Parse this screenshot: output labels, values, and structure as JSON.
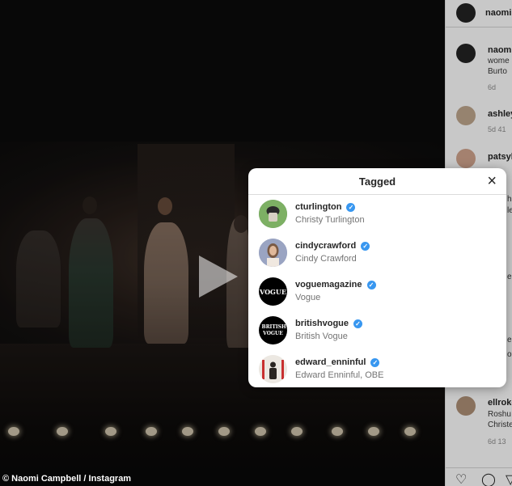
{
  "video": {
    "credit": "© Naomi Campbell / Instagram"
  },
  "panel": {
    "header_name": "naomi",
    "comments": [
      {
        "name": "naomi",
        "text1": "wome",
        "text2": "Burto",
        "meta": "6d"
      },
      {
        "name": "ashley",
        "meta": "5d  41"
      },
      {
        "name": "patsyk"
      },
      {
        "name": "ellroke",
        "text1": "Roshu",
        "text2": "Christe",
        "meta": "6d  13"
      }
    ],
    "partial_right_chars": [
      "ha",
      "le",
      "e",
      "e",
      "o"
    ]
  },
  "modal": {
    "title": "Tagged",
    "close_icon": "×",
    "tags": [
      {
        "username": "cturlington",
        "full_name": "Christy Turlington",
        "verified": "✓",
        "avatar_color": "#5a8a4a"
      },
      {
        "username": "cindycrawford",
        "full_name": "Cindy Crawford",
        "verified": "✓",
        "avatar_color": "#8a95b8"
      },
      {
        "username": "voguemagazine",
        "full_name": "Vogue",
        "verified": "✓",
        "avatar_color": "#000000",
        "logo": "VOGUE"
      },
      {
        "username": "britishvogue",
        "full_name": "British Vogue",
        "verified": "✓",
        "avatar_color": "#000000",
        "logo": "BRITISH VOGUE"
      },
      {
        "username": "edward_enninful",
        "full_name": "Edward Enninful, OBE",
        "verified": "✓",
        "avatar_color": "#e8e4de"
      }
    ]
  },
  "actions": {
    "like_icon": "♡",
    "comment_icon": "◯",
    "share_icon": "▽"
  }
}
